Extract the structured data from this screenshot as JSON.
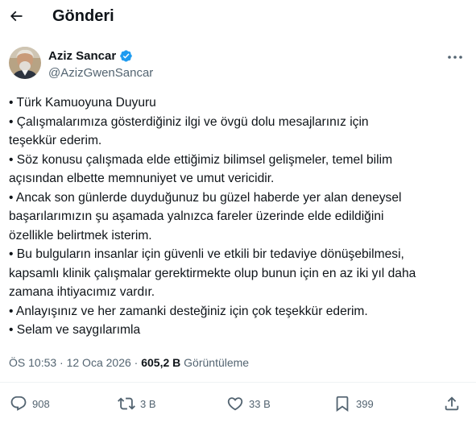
{
  "header": {
    "title": "Gönderi",
    "back_icon": "arrow-left-icon"
  },
  "author": {
    "display_name": "Aziz Sancar",
    "handle": "@AzizGwenSancar",
    "verified_color": "#1d9bf0",
    "avatar_icon": "profile-photo",
    "more_icon": "more-horizontal-icon"
  },
  "tweet": {
    "lines": [
      "• Türk Kamuoyuna Duyuru",
      "• Çalışmalarımıza gösterdiğiniz ilgi ve övgü dolu mesajlarınız için",
      "teşekkür ederim.",
      "• Söz konusu çalışmada elde ettiğimiz bilimsel gelişmeler, temel bilim",
      "açısından elbette memnuniyet ve umut vericidir.",
      "• Ancak son günlerde duyduğunuz bu güzel haberde yer alan deneysel",
      "başarılarımızın şu aşamada yalnızca fareler üzerinde elde edildiğini",
      "özellikle belirtmek isterim.",
      "• Bu bulguların insanlar için güvenli ve etkili bir tedaviye dönüşebilmesi,",
      "kapsamlı klinik çalışmalar gerektirmekte olup bunun için en az iki yıl daha",
      "zamana ihtiyacımız vardır.",
      "• Anlayışınız ve her zamanki desteğiniz için çok teşekkür ederim.",
      "• Selam ve saygılarımla"
    ]
  },
  "meta": {
    "time_date": "ÖS 10:53 · 12 Oca 2026 · ",
    "views_count": "605,2 B",
    "views_label": " Görüntüleme"
  },
  "actions": {
    "replies": {
      "icon": "reply-icon",
      "count": "908"
    },
    "reposts": {
      "icon": "repost-icon",
      "count": "3 B"
    },
    "likes": {
      "icon": "heart-icon",
      "count": "33 B"
    },
    "bookmarks": {
      "icon": "bookmark-icon",
      "count": "399"
    },
    "share": {
      "icon": "share-icon"
    }
  },
  "colors": {
    "text": "#0f1419",
    "secondary": "#536471",
    "accent": "#1d9bf0"
  }
}
